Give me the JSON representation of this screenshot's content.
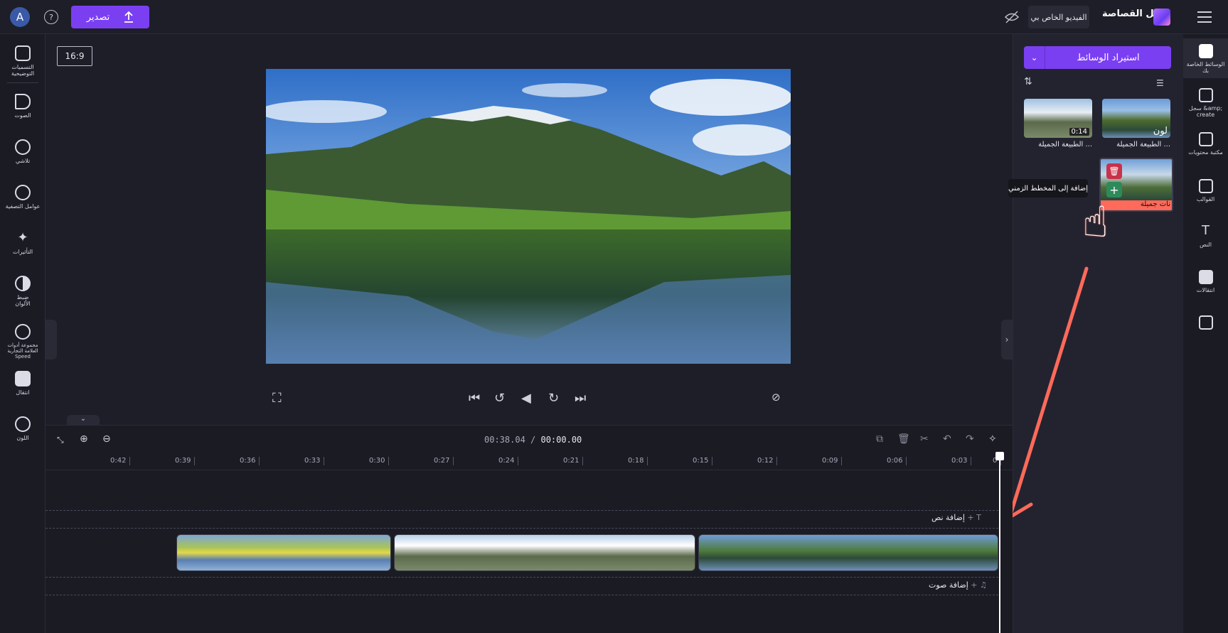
{
  "header": {
    "avatar_letter": "A",
    "help_icon": "help-icon",
    "export_label": "تصدير",
    "video_title": "الفيديو الخاص بي",
    "brand_name": "بطل القصاصة"
  },
  "left_toolbar": {
    "items": [
      {
        "icon": "captions-icon",
        "label": "التسميات التوضيحية"
      },
      {
        "icon": "audio-icon",
        "label": "الصوت"
      },
      {
        "icon": "fade-icon",
        "label": "تلاشي"
      },
      {
        "icon": "filters-icon",
        "label": "عوامل التصفية"
      },
      {
        "icon": "effects-icon",
        "label": "التأثيرات"
      },
      {
        "icon": "color-adjust-icon",
        "label": "ضبط الألوان"
      },
      {
        "icon": "speed-icon",
        "label": "مجموعة أدوات العلامة التجارية Speed"
      },
      {
        "icon": "transition-icon",
        "label": "انتقال"
      },
      {
        "icon": "color-icon",
        "label": "اللون"
      }
    ]
  },
  "preview": {
    "aspect_ratio": "16:9",
    "fullscreen_icon": "fullscreen-icon",
    "skip_back_icon": "skip-back-icon",
    "rewind_icon": "rewind-5-icon",
    "play_icon": "play-icon",
    "forward_icon": "forward-5-icon",
    "skip_forward_icon": "skip-forward-icon",
    "hide_preview_icon": "hide-preview-icon"
  },
  "media_panel": {
    "import_label": "استيراد الوسائط",
    "items": [
      {
        "label": "الطبيعة الجميلة ...",
        "overlay": "لون",
        "duration": ""
      },
      {
        "label": "الطبيعة الجميلة ...",
        "overlay": "",
        "duration": "0:14"
      },
      {
        "label": "نات جميلة",
        "overlay": "",
        "duration": ""
      }
    ],
    "tooltip": "إضافة إلى المخطط الزمني"
  },
  "right_toolbar": {
    "items": [
      {
        "icon": "folder-icon",
        "label": "الوسائط الخاصة بك"
      },
      {
        "icon": "record-icon",
        "label": "سجل &amp; create"
      },
      {
        "icon": "content-library-icon",
        "label": "مكتبة محتويات"
      },
      {
        "icon": "templates-icon",
        "label": "القوالب"
      },
      {
        "icon": "text-icon",
        "label": "النص"
      },
      {
        "icon": "transitions-icon",
        "label": "انتقالات"
      },
      {
        "icon": "brand-icon",
        "label": ""
      }
    ]
  },
  "timeline": {
    "time_current": "00:00.00",
    "time_total": "00:38.04",
    "ruler_ticks": [
      "0",
      "0:03",
      "0:06",
      "0:09",
      "0:12",
      "0:15",
      "0:18",
      "0:21",
      "0:24",
      "0:27",
      "0:30",
      "0:33",
      "0:36",
      "0:39",
      "0:42"
    ],
    "add_text_label": "إضافة نص",
    "add_audio_label": "إضافة صوت"
  }
}
